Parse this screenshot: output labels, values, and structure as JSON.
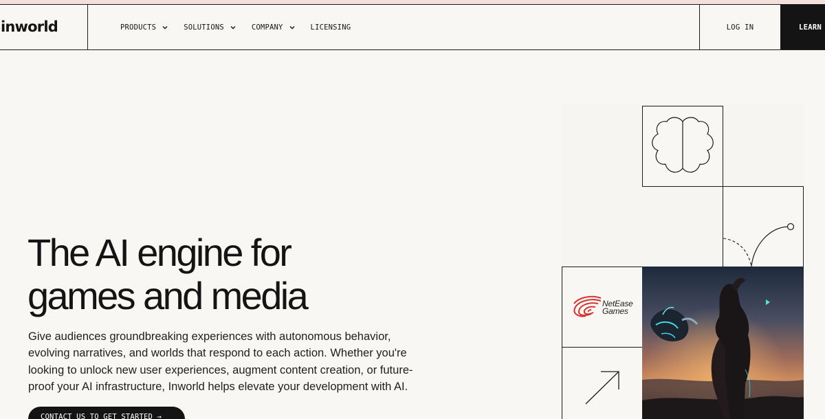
{
  "brand": {
    "logo_text": "inworld"
  },
  "nav": {
    "items": [
      {
        "label": "PRODUCTS",
        "has_dropdown": true
      },
      {
        "label": "SOLUTIONS",
        "has_dropdown": true
      },
      {
        "label": "COMPANY",
        "has_dropdown": true
      },
      {
        "label": "LICENSING",
        "has_dropdown": false
      }
    ],
    "login_label": "LOG IN",
    "learn_label": "LEARN"
  },
  "hero": {
    "title_line1": "The AI engine for",
    "title_line2": "games and media",
    "description": "Give audiences groundbreaking experiences with autonomous behavior, evolving narratives, and worlds that respond to each action. Whether you're looking to unlock new user experiences, augment content creation, or future-proof your AI infrastructure, Inworld helps elevate your development with AI.",
    "cta_label": "CONTACT US TO GET STARTED →"
  },
  "partner": {
    "name_line1": "NetEase",
    "name_line2": "Games"
  },
  "icons": {
    "brain": "brain-icon",
    "curve": "curve-path-icon",
    "arrow": "arrow-up-right-icon",
    "logo": "netease-logo-icon",
    "chevron": "chevron-down-icon"
  },
  "colors": {
    "background": "#f9f7f3",
    "text": "#141414",
    "accent_dark": "#141414",
    "netease_red": "#d6322f",
    "top_strip": "#f4dfdc"
  }
}
